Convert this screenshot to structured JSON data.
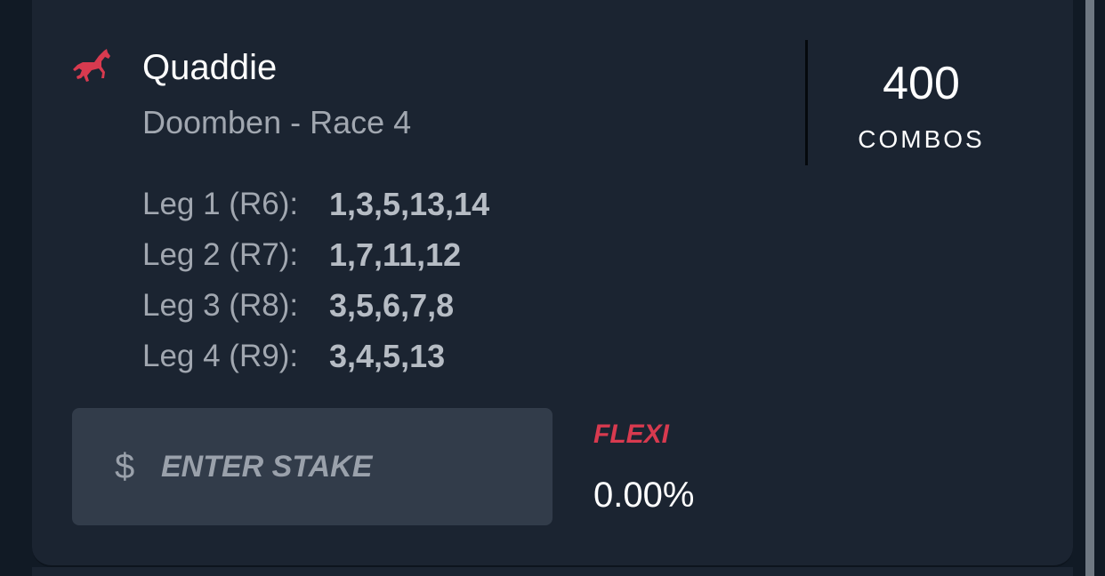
{
  "bet": {
    "type": "Quaddie",
    "meeting": "Doomben - Race 4",
    "combos_count": "400",
    "combos_label": "COMBOS",
    "accent_color": "#d83a4f",
    "icon": "horse-icon"
  },
  "legs": [
    {
      "label": "Leg 1 (R6):",
      "selections": "1,3,5,13,14"
    },
    {
      "label": "Leg 2 (R7):",
      "selections": "1,7,11,12"
    },
    {
      "label": "Leg 3 (R8):",
      "selections": "3,5,6,7,8"
    },
    {
      "label": "Leg 4 (R9):",
      "selections": "3,4,5,13"
    }
  ],
  "stake": {
    "currency_symbol": "$",
    "placeholder": "ENTER STAKE",
    "value": ""
  },
  "flexi": {
    "label": "FLEXI",
    "value": "0.00%"
  }
}
